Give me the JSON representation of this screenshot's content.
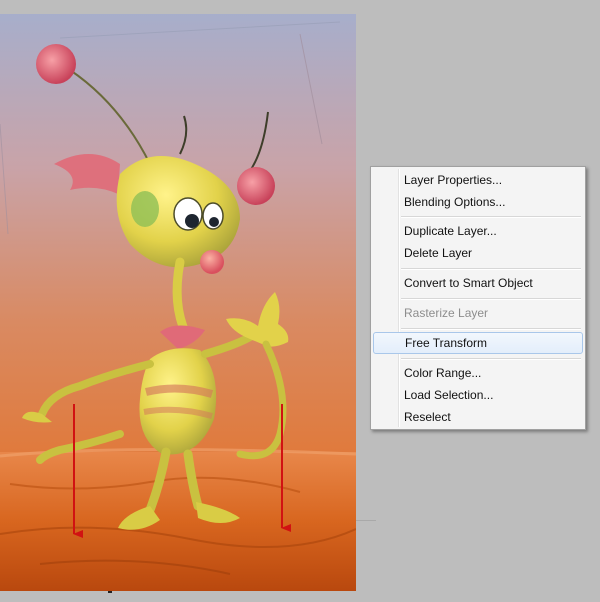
{
  "context_menu": {
    "items": [
      {
        "label": "Layer Properties...",
        "enabled": true
      },
      {
        "label": "Blending Options...",
        "enabled": true
      },
      {
        "label": "Duplicate Layer...",
        "enabled": true
      },
      {
        "label": "Delete Layer",
        "enabled": true
      },
      {
        "label": "Convert to Smart Object",
        "enabled": true
      },
      {
        "label": "Rasterize Layer",
        "enabled": false
      },
      {
        "label": "Free Transform",
        "enabled": true,
        "highlighted": true
      },
      {
        "label": "Color Range...",
        "enabled": true
      },
      {
        "label": "Load Selection...",
        "enabled": true
      },
      {
        "label": "Reselect",
        "enabled": true
      }
    ]
  },
  "colors": {
    "workspace": "#bdbdbd",
    "menu_background": "#f4f4f4",
    "menu_highlight_border": "#a9c7ea",
    "arrow": "#d11212",
    "sky_top": "#aab0c9",
    "sky_bottom": "#d8825e",
    "ground": "#d9641c"
  }
}
